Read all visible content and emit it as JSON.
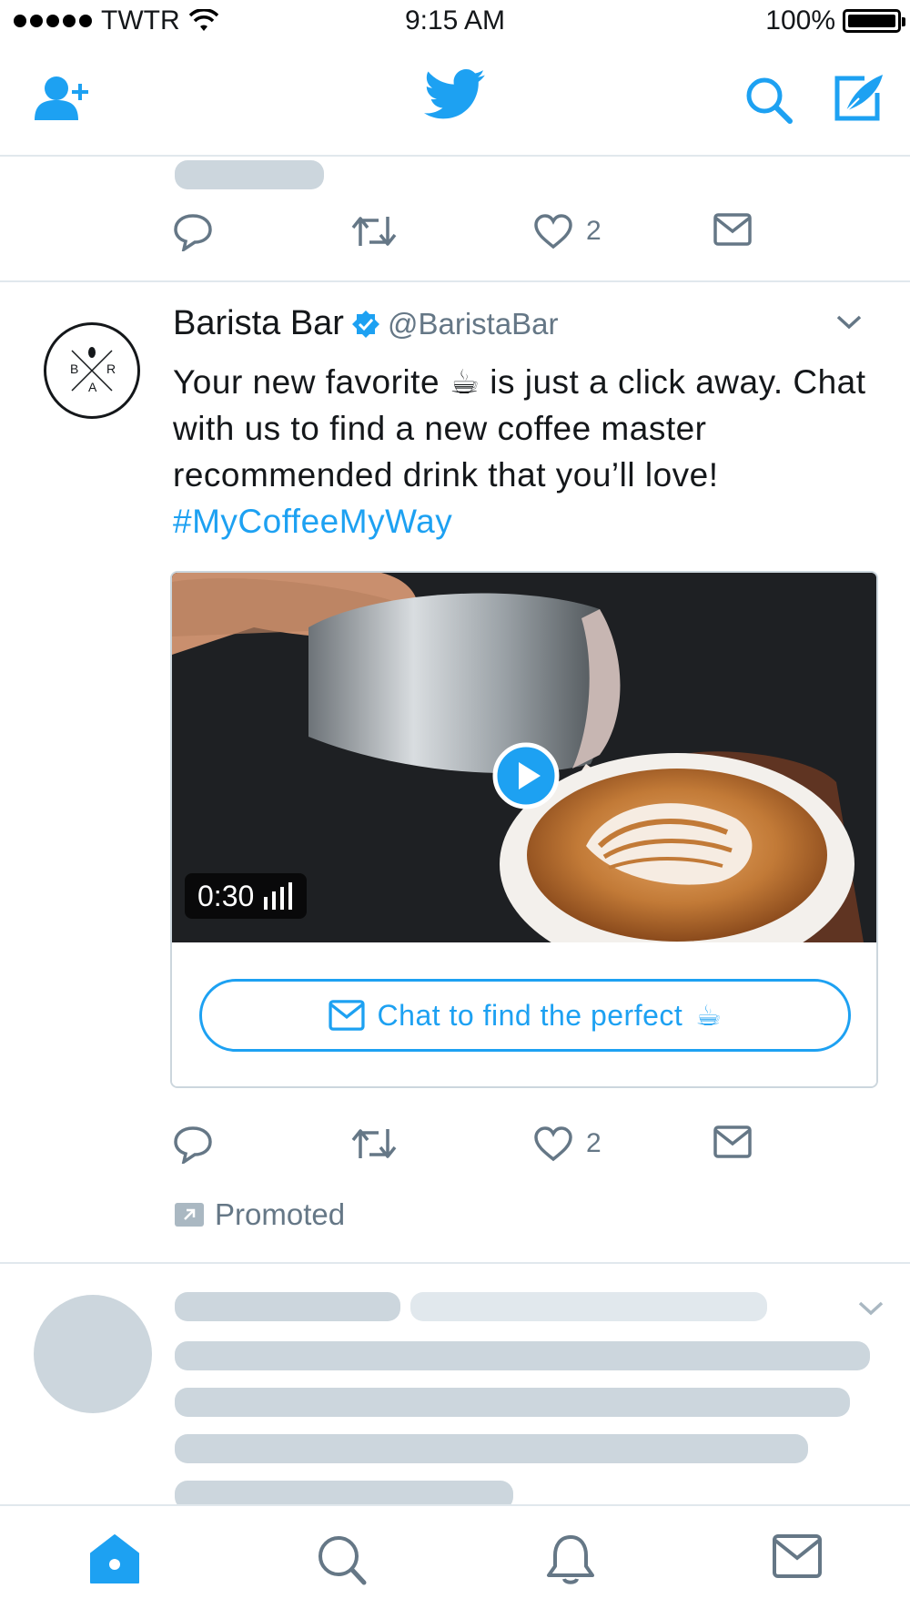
{
  "status_bar": {
    "carrier": "TWTR",
    "time": "9:15 AM",
    "battery": "100%"
  },
  "nav": {
    "add_user_icon": "add-user-icon",
    "logo_icon": "twitter-bird-icon",
    "search_icon": "search-icon",
    "compose_icon": "compose-icon"
  },
  "first_tweet": {
    "like_count": "2"
  },
  "promoted_tweet": {
    "display_name": "Barista Bar",
    "handle": "@BaristaBar",
    "avatar_letters": [
      "B",
      "R",
      "A"
    ],
    "text_before": "Your new favorite ",
    "emoji": "☕",
    "text_after": " is just a click away. Chat with us to find a new coffee master recommended drink that you’ll love!",
    "hashtag": "#MyCoffeeMyWay",
    "video_duration": "0:30",
    "cta_label": "Chat to find the perfect",
    "cta_emoji": "☕",
    "like_count": "2",
    "promoted_label": "Promoted"
  },
  "colors": {
    "accent": "#1da1f2",
    "text": "#14171a",
    "muted": "#657786",
    "skeleton": "#ccd6dd",
    "border": "#e1e8ed"
  }
}
